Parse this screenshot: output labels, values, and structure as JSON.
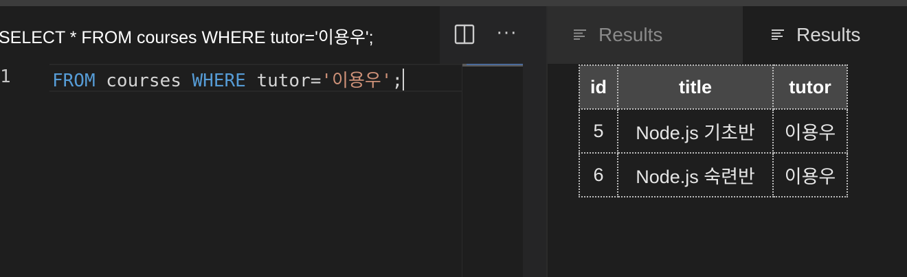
{
  "editor": {
    "tab_title": "SELECT * FROM courses WHERE tutor='이용우';",
    "line_number": "1",
    "code": {
      "kw_from": "FROM",
      "table_name": " courses ",
      "kw_where": "WHERE",
      "condition": " tutor=",
      "value": "'이용우'",
      "semicolon": ";"
    },
    "actions": {
      "split_icon": "split-editor-icon",
      "more_label": "···"
    }
  },
  "results_tabs": [
    {
      "label": "Results",
      "icon": "list-lines-icon",
      "active": false
    },
    {
      "label": "Results",
      "icon": "list-lines-icon",
      "active": true
    }
  ],
  "results": {
    "columns": [
      "id",
      "title",
      "tutor"
    ],
    "rows": [
      [
        "5",
        "Node.js 기초반",
        "이용우"
      ],
      [
        "6",
        "Node.js 숙련반",
        "이용우"
      ]
    ]
  },
  "colors": {
    "keyword": "#569cd6",
    "string": "#ce9178",
    "editor_bg": "#1e1e1e",
    "header_bg": "#474747"
  }
}
